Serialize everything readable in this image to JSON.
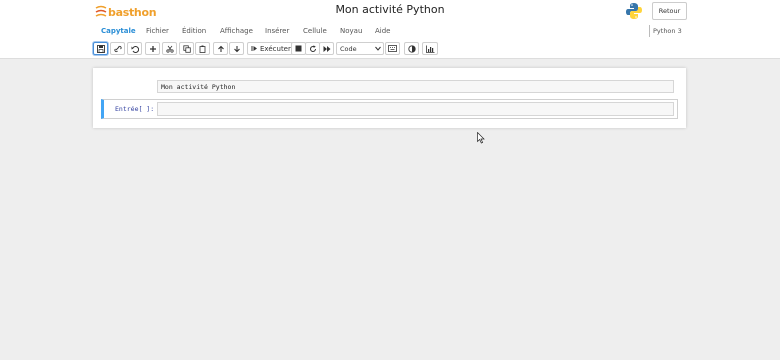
{
  "header": {
    "logo_part1": "bas",
    "logo_part2": "thon",
    "title": "Mon activité Python",
    "python_logo": "python-icon",
    "back_label": "Retour"
  },
  "menu": {
    "items": [
      {
        "label": "Capytale",
        "active": true
      },
      {
        "label": "Fichier"
      },
      {
        "label": "Édition"
      },
      {
        "label": "Affichage"
      },
      {
        "label": "Insérer"
      },
      {
        "label": "Cellule"
      },
      {
        "label": "Noyau"
      },
      {
        "label": "Aide"
      }
    ],
    "kernel": "Python 3"
  },
  "toolbar": {
    "buttons": [
      "save-icon",
      "link-icon",
      "undo-icon",
      "plus-icon",
      "cut-icon",
      "copy-icon",
      "paste-icon",
      "arrow-up-icon",
      "arrow-down-icon",
      "run-icon",
      "stop-icon",
      "restart-icon",
      "fast-forward-icon",
      "keyboard-icon",
      "contrast-icon",
      "chart-icon"
    ],
    "run_label": "Exécuter",
    "cell_type": "Code"
  },
  "notebook": {
    "markdown_text": "Mon activité Python",
    "code_prompt": "Entrée[ ]:",
    "code_value": ""
  },
  "colors": {
    "accent": "#2a8ed6",
    "cell_border_active": "#42a5f5",
    "logo_orange": "#f0a02c",
    "background": "#eeeeee"
  }
}
